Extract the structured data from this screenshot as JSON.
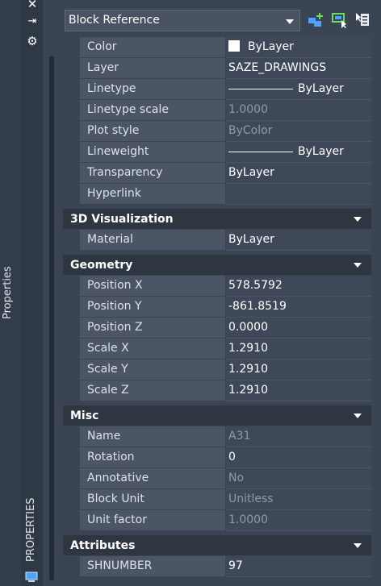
{
  "palette": {
    "side_title": "Properties",
    "tab_label": "PROPERTIES",
    "tool_icons": [
      "close-icon",
      "pin-icon",
      "gear-icon"
    ]
  },
  "toolbar": {
    "selection_type": "Block Reference",
    "icons": [
      "toggle-pickadd-icon",
      "select-objects-icon",
      "quick-select-icon"
    ]
  },
  "general": {
    "rows": [
      {
        "name": "Color",
        "value": "ByLayer"
      },
      {
        "name": "Layer",
        "value": "SAZE_DRAWINGS"
      },
      {
        "name": "Linetype",
        "value": "ByLayer"
      },
      {
        "name": "Linetype scale",
        "value": "1.0000"
      },
      {
        "name": "Plot style",
        "value": "ByColor"
      },
      {
        "name": "Lineweight",
        "value": "ByLayer"
      },
      {
        "name": "Transparency",
        "value": "ByLayer"
      },
      {
        "name": "Hyperlink",
        "value": ""
      }
    ]
  },
  "visualization": {
    "title": "3D Visualization",
    "rows": [
      {
        "name": "Material",
        "value": "ByLayer"
      }
    ]
  },
  "geometry": {
    "title": "Geometry",
    "rows": [
      {
        "name": "Position X",
        "value": "578.5792"
      },
      {
        "name": "Position Y",
        "value": "-861.8519"
      },
      {
        "name": "Position Z",
        "value": "0.0000"
      },
      {
        "name": "Scale X",
        "value": "1.2910"
      },
      {
        "name": "Scale Y",
        "value": "1.2910"
      },
      {
        "name": "Scale Z",
        "value": "1.2910"
      }
    ]
  },
  "misc": {
    "title": "Misc",
    "rows": [
      {
        "name": "Name",
        "value": "A31"
      },
      {
        "name": "Rotation",
        "value": "0"
      },
      {
        "name": "Annotative",
        "value": "No"
      },
      {
        "name": "Block Unit",
        "value": "Unitless"
      },
      {
        "name": "Unit factor",
        "value": "1.0000"
      }
    ]
  },
  "attributes": {
    "title": "Attributes",
    "rows": [
      {
        "name": "SHNUMBER",
        "value": "97"
      }
    ]
  },
  "colors": {
    "background": "#3b4453",
    "name_cell": "#4b5565",
    "value_cell": "#3f4858",
    "section_header": "#2e3642",
    "readonly_text": "#8f99a8"
  }
}
